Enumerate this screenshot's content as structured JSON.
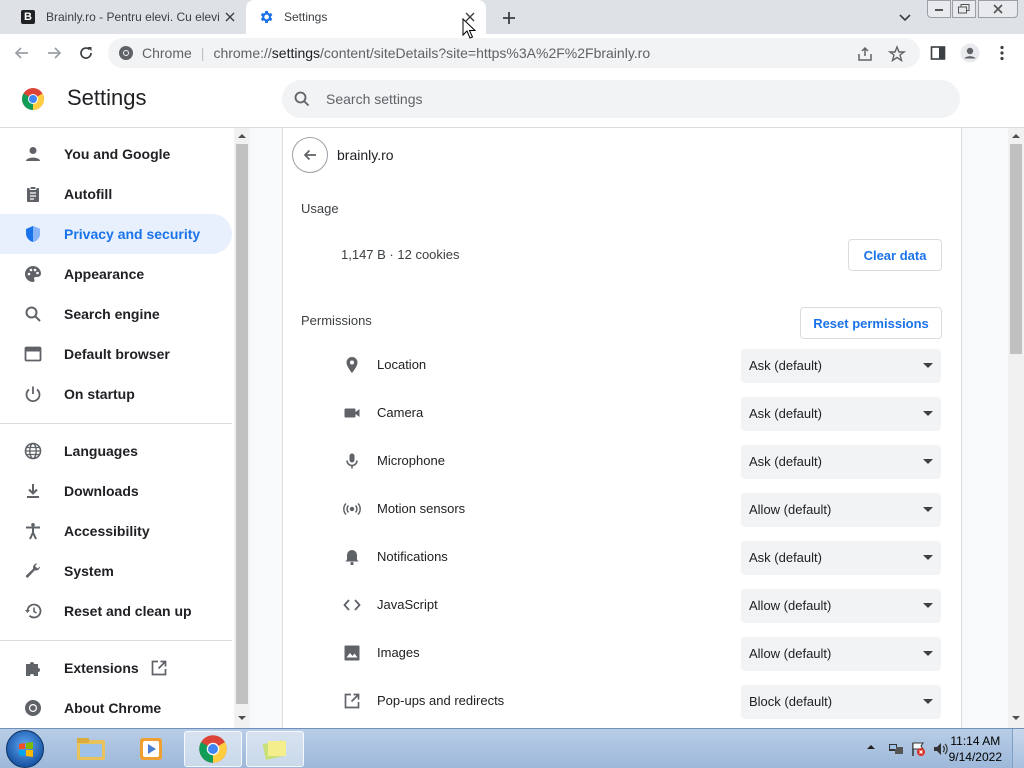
{
  "tabs": [
    {
      "title": "Brainly.ro - Pentru elevi. Cu elevi.",
      "favicon": "brainly-icon"
    },
    {
      "title": "Settings",
      "favicon": "settings-gear-icon",
      "active": true
    }
  ],
  "omnibox": {
    "scheme_label": "Chrome",
    "url_prefix": "chrome://",
    "url_host": "settings",
    "url_rest": "/content/siteDetails?site=https%3A%2F%2Fbrainly.ro"
  },
  "header": {
    "title": "Settings",
    "search_placeholder": "Search settings"
  },
  "sidebar": {
    "items": [
      {
        "label": "You and Google",
        "icon": "person-icon"
      },
      {
        "label": "Autofill",
        "icon": "clipboard-icon"
      },
      {
        "label": "Privacy and security",
        "icon": "shield-icon",
        "active": true
      },
      {
        "label": "Appearance",
        "icon": "palette-icon"
      },
      {
        "label": "Search engine",
        "icon": "search-icon"
      },
      {
        "label": "Default browser",
        "icon": "browser-window-icon"
      },
      {
        "label": "On startup",
        "icon": "power-icon"
      },
      {
        "label": "Languages",
        "icon": "globe-icon"
      },
      {
        "label": "Downloads",
        "icon": "download-icon"
      },
      {
        "label": "Accessibility",
        "icon": "accessibility-icon"
      },
      {
        "label": "System",
        "icon": "wrench-icon"
      },
      {
        "label": "Reset and clean up",
        "icon": "history-reset-icon"
      },
      {
        "label": "Extensions",
        "icon": "puzzle-icon"
      },
      {
        "label": "About Chrome",
        "icon": "chrome-icon"
      }
    ]
  },
  "site": {
    "name": "brainly.ro",
    "usage_title": "Usage",
    "usage_text": "1,147 B · 12 cookies",
    "clear_data_label": "Clear data",
    "permissions_title": "Permissions",
    "reset_permissions_label": "Reset permissions",
    "permissions": [
      {
        "label": "Location",
        "value": "Ask (default)",
        "icon": "location-pin-icon"
      },
      {
        "label": "Camera",
        "value": "Ask (default)",
        "icon": "camera-icon"
      },
      {
        "label": "Microphone",
        "value": "Ask (default)",
        "icon": "microphone-icon"
      },
      {
        "label": "Motion sensors",
        "value": "Allow (default)",
        "icon": "motion-sensors-icon"
      },
      {
        "label": "Notifications",
        "value": "Ask (default)",
        "icon": "bell-icon"
      },
      {
        "label": "JavaScript",
        "value": "Allow (default)",
        "icon": "code-icon"
      },
      {
        "label": "Images",
        "value": "Allow (default)",
        "icon": "image-icon"
      },
      {
        "label": "Pop-ups and redirects",
        "value": "Block (default)",
        "icon": "open-in-new-icon"
      }
    ]
  },
  "taskbar": {
    "time": "11:14 AM",
    "date": "9/14/2022"
  },
  "colors": {
    "accent": "#1a73e8",
    "active_nav_bg": "#e8f0fe",
    "tabstrip": "#dee1e6"
  }
}
